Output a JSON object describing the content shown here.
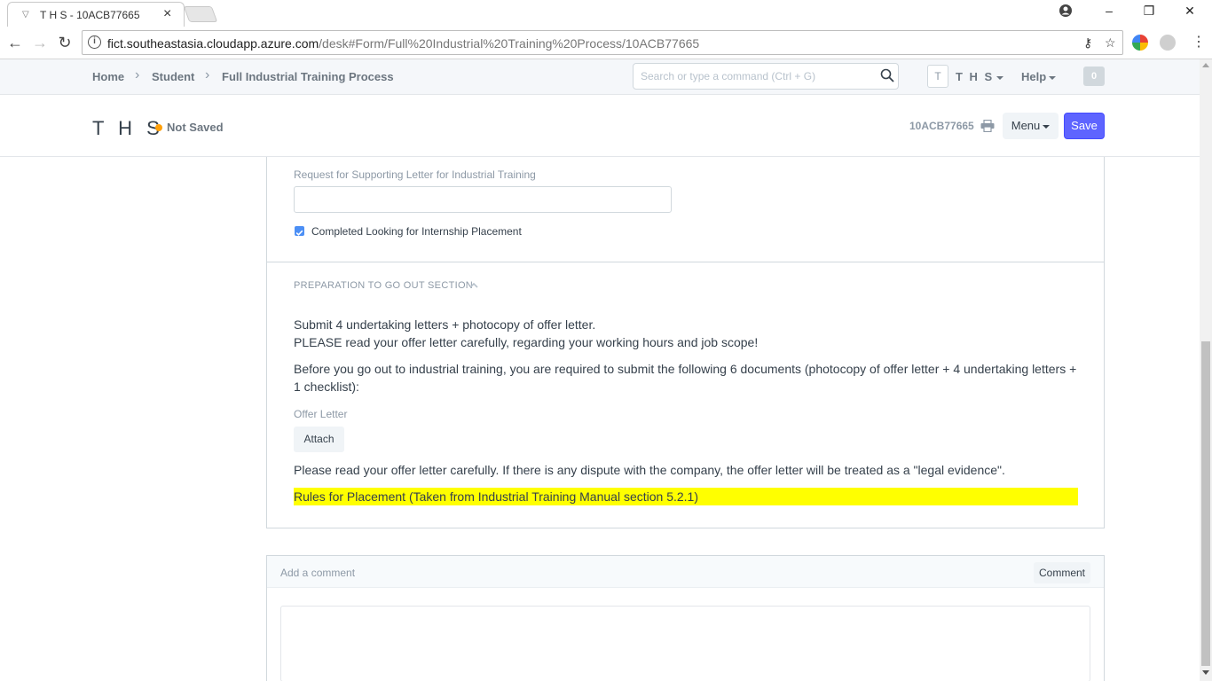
{
  "browser": {
    "tab_title": "T H S - 10ACB77665",
    "url_host": "fict.southeastasia.cloudapp.azure.com",
    "url_path": "/desk#Form/Full%20Industrial%20Training%20Process/10ACB77665"
  },
  "navbar": {
    "breadcrumbs": [
      "Home",
      "Student",
      "Full Industrial Training Process"
    ],
    "search_placeholder": "Search or type a command (Ctrl + G)",
    "user_initial": "T",
    "user_name": "T H S",
    "help_label": "Help",
    "notification_count": "0"
  },
  "page_head": {
    "title": "T H S",
    "status": "Not Saved",
    "doc_name": "10ACB77665",
    "menu_label": "Menu",
    "save_label": "Save"
  },
  "form": {
    "supporting_letter_label": "Request for Supporting Letter for Industrial Training",
    "supporting_letter_value": "",
    "completed_checkbox_label": "Completed Looking for Internship Placement",
    "completed_checked": true,
    "section_title": "PREPARATION TO GO OUT SECTION",
    "intro_line1": "Submit 4 undertaking letters + photocopy of offer letter.",
    "intro_line2": "PLEASE read your offer letter carefully, regarding your working hours and job scope!",
    "docs_paragraph": "Before you go out to industrial training, you are required to submit the following 6 documents (photocopy of offer letter + 4 undertaking letters + 1 checklist):",
    "offer_letter_label": "Offer Letter",
    "attach_label": "Attach",
    "dispute_paragraph": "Please read your offer letter carefully. If there is any dispute with the company, the offer letter will be treated as a \"legal evidence\".",
    "rules_highlight": "Rules for Placement (Taken from Industrial Training Manual section 5.2.1)"
  },
  "comments": {
    "title": "Add a comment",
    "button_label": "Comment"
  },
  "colors": {
    "primary": "#5e64ff",
    "status_dot": "#ffa00a",
    "highlight": "#ffff00",
    "checkbox": "#4c8ff5"
  }
}
